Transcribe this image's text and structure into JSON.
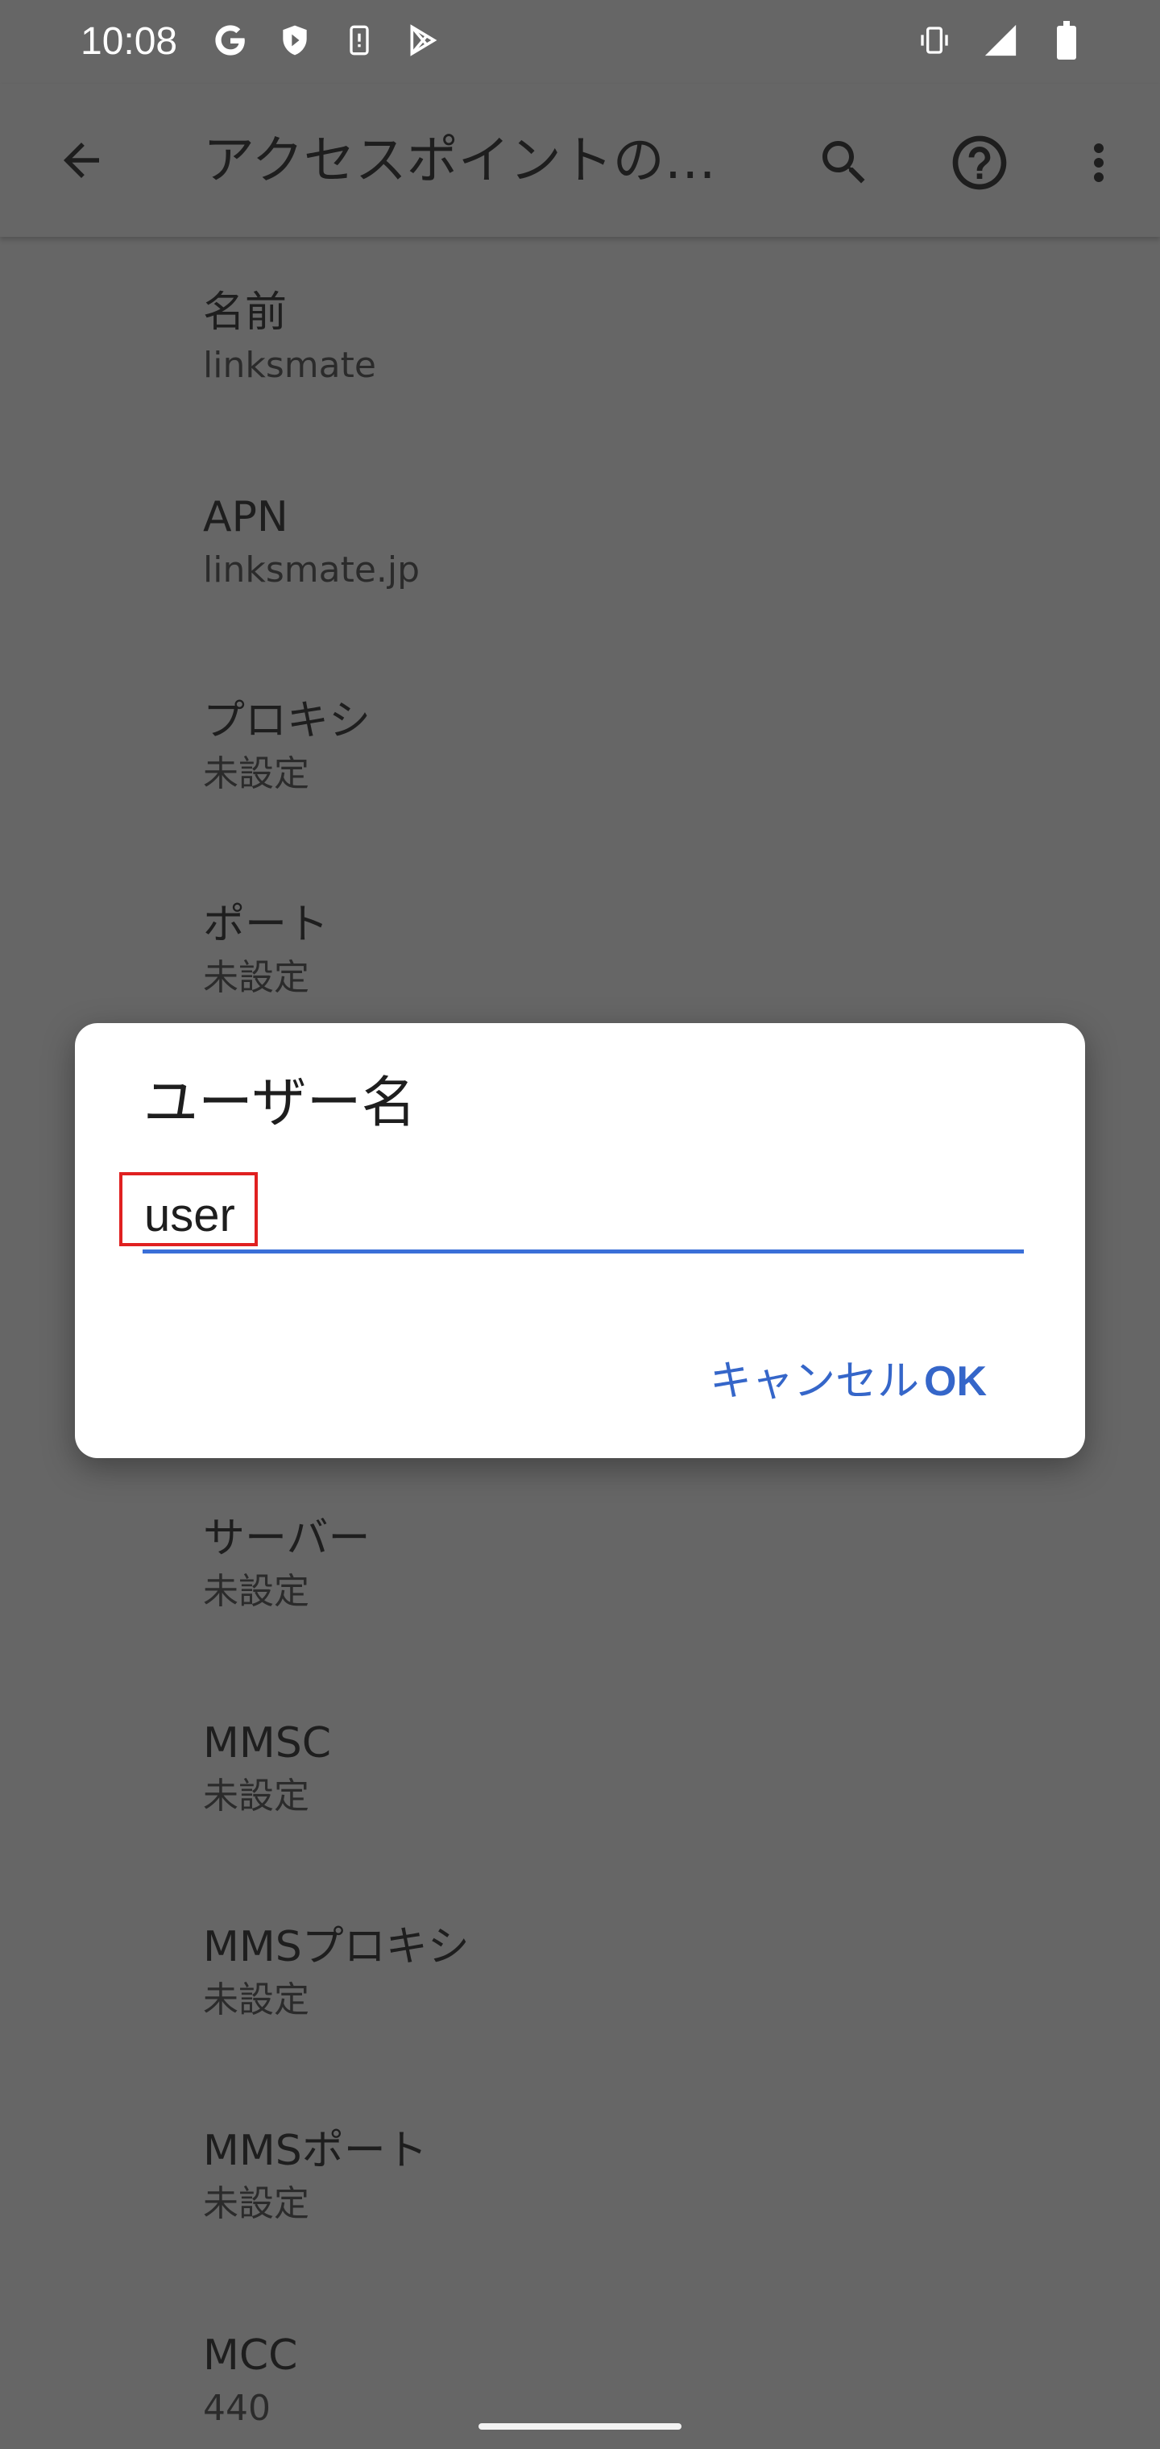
{
  "status_bar": {
    "time": "10:08",
    "left_icons": [
      "google-icon",
      "shield-icon",
      "device-icon",
      "play-store-icon"
    ],
    "right_icons": [
      "vibrate-icon",
      "signal-icon",
      "battery-icon"
    ]
  },
  "app_bar": {
    "title": "アクセスポイントの…",
    "back_icon": "arrow-back-icon",
    "search_icon": "search-icon",
    "help_icon": "help-icon",
    "more_icon": "more-vert-icon"
  },
  "settings": {
    "items": [
      {
        "title": "名前",
        "summary": "linksmate"
      },
      {
        "title": "APN",
        "summary": "linksmate.jp"
      },
      {
        "title": "プロキシ",
        "summary": "未設定"
      },
      {
        "title": "ポート",
        "summary": "未設定"
      },
      {
        "title": "サーバー",
        "summary": "未設定"
      },
      {
        "title": "MMSC",
        "summary": "未設定"
      },
      {
        "title": "MMSプロキシ",
        "summary": "未設定"
      },
      {
        "title": "MMSポート",
        "summary": "未設定"
      },
      {
        "title": "MCC",
        "summary": "440"
      }
    ]
  },
  "dialog": {
    "title": "ユーザー名",
    "input_value": "user",
    "cancel_label": "キャンセル",
    "ok_label": "OK"
  },
  "colors": {
    "scrim_background": "#666666",
    "dialog_background": "#ffffff",
    "accent": "#3566c9",
    "underline": "#3a6fd8",
    "highlight": "#e02020"
  }
}
